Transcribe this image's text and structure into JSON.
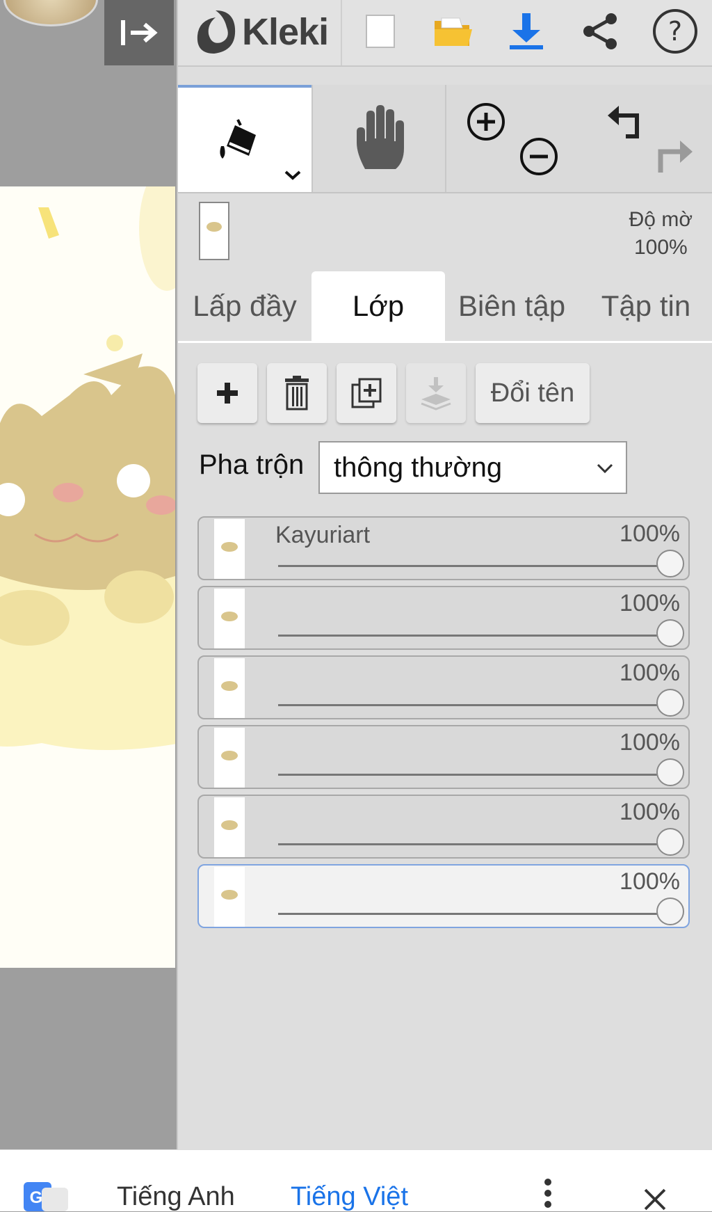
{
  "app": {
    "name": "Kleki"
  },
  "toolbar": {
    "icons": [
      "collapse-icon",
      "new-image-icon",
      "open-folder-icon",
      "download-icon",
      "share-icon",
      "help-icon"
    ]
  },
  "tools": {
    "active": "fill-bucket",
    "items": [
      "fill-bucket-icon",
      "hand-icon",
      "zoom-in-icon",
      "zoom-out-icon",
      "undo-icon",
      "redo-icon"
    ]
  },
  "layer_info": {
    "opacity_label": "Độ mờ",
    "opacity_value": "100%"
  },
  "tabs": [
    {
      "label": "Lấp đầy"
    },
    {
      "label": "Lớp"
    },
    {
      "label": "Biên tập"
    },
    {
      "label": "Tập tin"
    }
  ],
  "active_tab": "Lớp",
  "layer_actions": {
    "rename_label": "Đổi tên"
  },
  "blend": {
    "label": "Pha trộn",
    "value": "thông thường"
  },
  "layers": [
    {
      "name": "Kayuriart",
      "opacity": "100%",
      "level": 1.0,
      "selected": false
    },
    {
      "name": "",
      "opacity": "100%",
      "level": 1.0,
      "selected": false
    },
    {
      "name": "",
      "opacity": "100%",
      "level": 1.0,
      "selected": false
    },
    {
      "name": "",
      "opacity": "100%",
      "level": 1.0,
      "selected": false
    },
    {
      "name": "",
      "opacity": "100%",
      "level": 1.0,
      "selected": false
    },
    {
      "name": "",
      "opacity": "100%",
      "level": 1.0,
      "selected": true
    }
  ],
  "translate_bar": {
    "source_lang": "Tiếng Anh",
    "target_lang": "Tiếng Việt"
  },
  "colors": {
    "accent": "#1a73e8",
    "tab_active_border": "#7aa0d8",
    "panel_bg": "#dedede"
  }
}
